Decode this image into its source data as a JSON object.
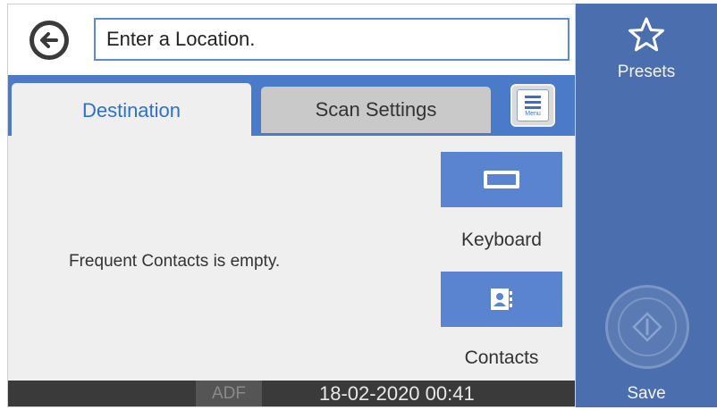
{
  "header": {
    "location_placeholder": "Enter a Location.",
    "icons": {
      "back": "back-arrow-icon"
    }
  },
  "tabs": [
    {
      "label": "Destination",
      "selected": true
    },
    {
      "label": "Scan Settings",
      "selected": false
    }
  ],
  "menu_button": {
    "label": "Menu",
    "icon": "menu-icon"
  },
  "content": {
    "empty_message": "Frequent Contacts is empty.",
    "keyboard_label": "Keyboard",
    "contacts_label": "Contacts",
    "icons": {
      "keyboard": "keyboard-icon",
      "contacts": "contact-card-icon"
    }
  },
  "status": {
    "source": "ADF",
    "datetime": "18-02-2020 00:41"
  },
  "side_panel": {
    "presets_label": "Presets",
    "save_label": "Save",
    "icons": {
      "presets": "star-icon",
      "start": "start-icon"
    }
  },
  "colors": {
    "accent_blue": "#4b7bc8",
    "side_panel": "#4b6fae",
    "selected_tab_text": "#2f6fd0",
    "status_bar": "#3a3a3a"
  }
}
